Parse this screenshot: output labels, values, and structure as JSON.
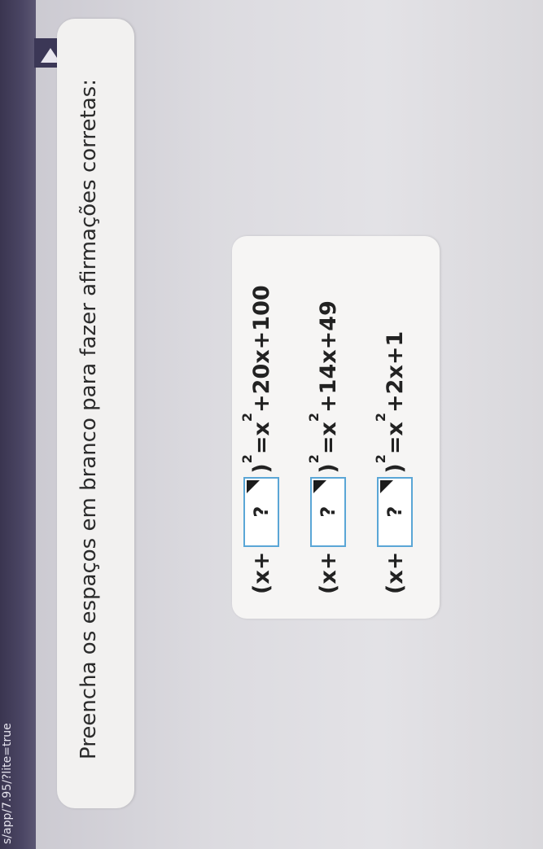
{
  "browser": {
    "url": "s/app/7.95/?lite=true"
  },
  "prompt": "Preencha os espaços em branco para fazer afirmações corretas:",
  "equations": [
    {
      "prefix": "(x+",
      "blank": "?",
      "suffix": ")",
      "exp": "2",
      "rhs_a": "=x",
      "rhs_exp": "2",
      "rhs_b": "+20x+100"
    },
    {
      "prefix": "(x+",
      "blank": "?",
      "suffix": ")",
      "exp": "2",
      "rhs_a": "=x",
      "rhs_exp": "2",
      "rhs_b": "+14x+49"
    },
    {
      "prefix": "(x+",
      "blank": "?",
      "suffix": ")",
      "exp": "2",
      "rhs_a": "=x",
      "rhs_exp": "2",
      "rhs_b": "+2x+1"
    }
  ],
  "colors": {
    "blank_border": "#5aa6d6",
    "card": "#f6f5f4",
    "banner": "#f2f1f0"
  }
}
